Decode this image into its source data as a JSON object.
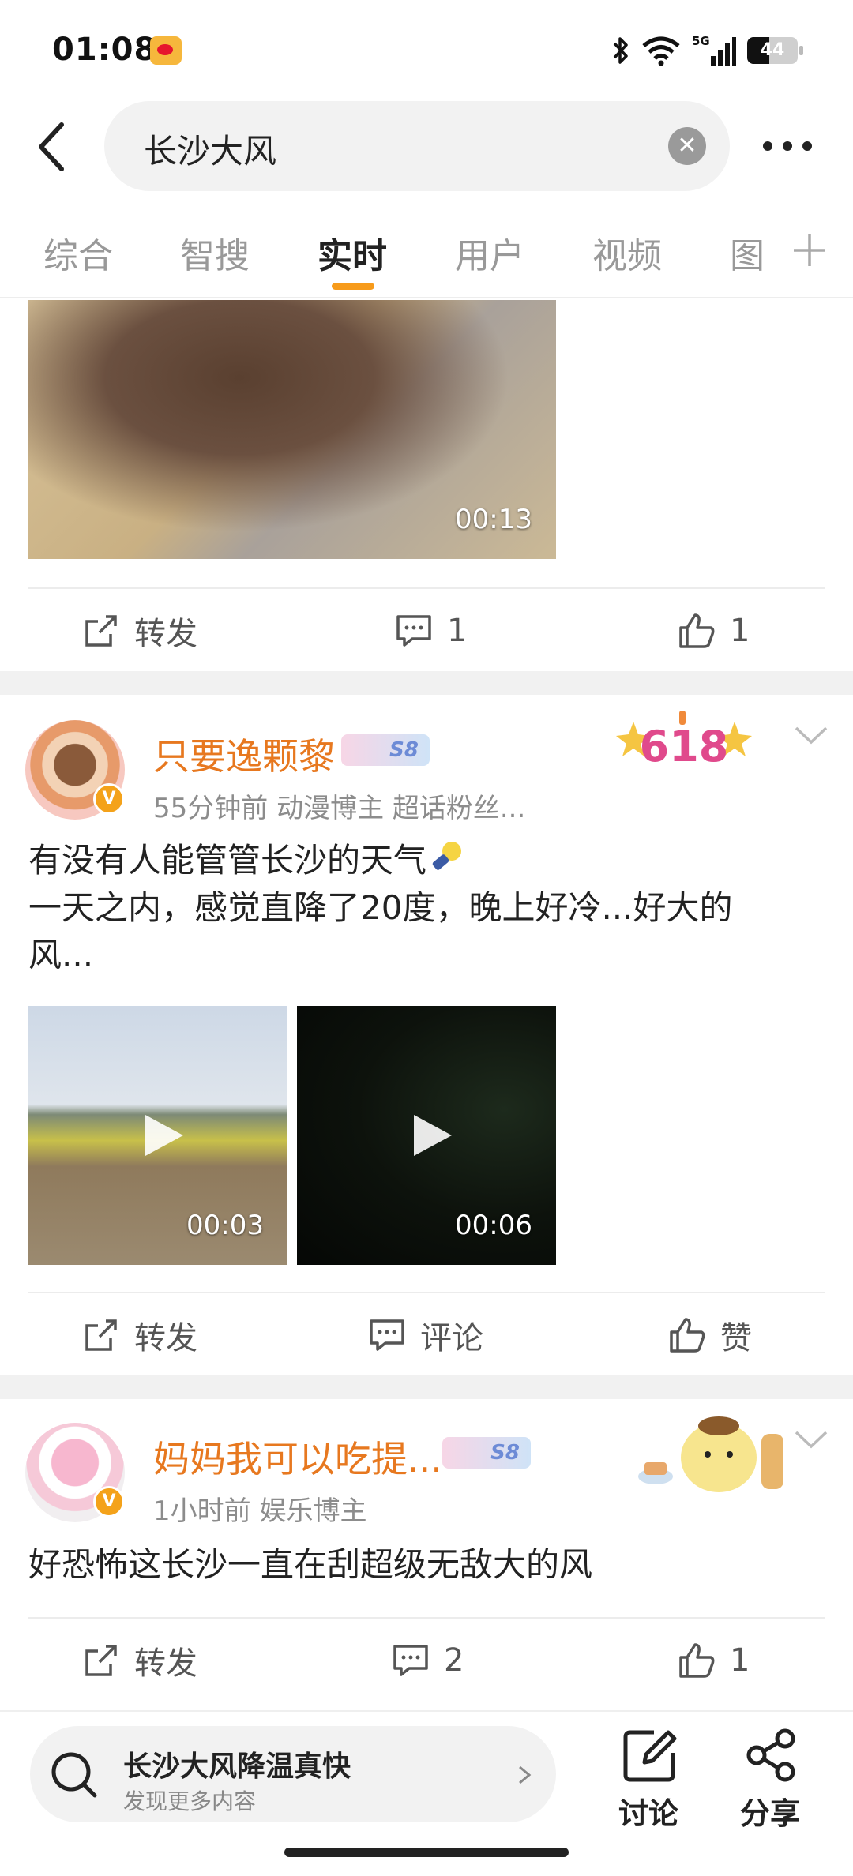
{
  "status_bar": {
    "time": "01:08",
    "battery": "44",
    "battery_level_percent": 44,
    "network": "5G"
  },
  "search": {
    "query": "长沙大风"
  },
  "tabs": [
    {
      "label": "综合"
    },
    {
      "label": "智搜"
    },
    {
      "label": "实时",
      "active": true
    },
    {
      "label": "用户"
    },
    {
      "label": "视频"
    },
    {
      "label": "图"
    }
  ],
  "accent_color": "#f79b1b",
  "username_color": "#e7781f",
  "feed": {
    "partial_post": {
      "video_duration": "00:13",
      "actions": {
        "repost": "转发",
        "comments": "1",
        "likes": "1"
      }
    },
    "posts": [
      {
        "username": "只要逸颗黎",
        "level": "S8",
        "meta": "55分钟前   动漫博主 超话粉丝...",
        "decoration": "618",
        "text_lines": [
          "有没有人能管管长沙的天气",
          "一天之内，感觉直降了20度，晚上好冷...好大的",
          "风..."
        ],
        "videos": [
          {
            "duration": "00:03"
          },
          {
            "duration": "00:06"
          }
        ],
        "actions": {
          "repost": "转发",
          "comment": "评论",
          "like": "赞"
        }
      },
      {
        "username": "妈妈我可以吃提...",
        "level": "S8",
        "meta": "1小时前   娱乐博主",
        "text_lines": [
          "好恐怖这长沙一直在刮超级无敌大的风"
        ],
        "actions": {
          "repost": "转发",
          "comments": "2",
          "likes": "1"
        }
      }
    ]
  },
  "bottom_bar": {
    "hot_search_title": "长沙大风降温真快",
    "hot_search_sub": "发现更多内容",
    "discuss_label": "讨论",
    "share_label": "分享"
  }
}
